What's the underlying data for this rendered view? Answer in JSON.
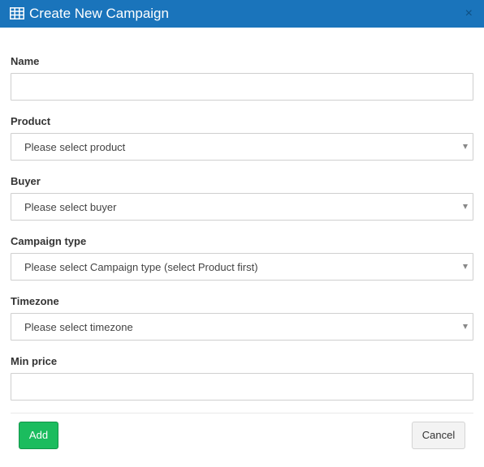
{
  "modal": {
    "title": "Create New Campaign",
    "close_glyph": "×",
    "header_icon": "table-icon",
    "header_color": "#1a74bb"
  },
  "form": {
    "name": {
      "label": "Name",
      "value": "",
      "placeholder": ""
    },
    "product": {
      "label": "Product",
      "selected": "Please select product"
    },
    "buyer": {
      "label": "Buyer",
      "selected": "Please select buyer"
    },
    "campaign_type": {
      "label": "Campaign type",
      "selected": "Please select Campaign type (select Product first)"
    },
    "timezone": {
      "label": "Timezone",
      "selected": "Please select timezone"
    },
    "min_price": {
      "label": "Min price",
      "value": "",
      "placeholder": ""
    }
  },
  "footer": {
    "add_label": "Add",
    "cancel_label": "Cancel",
    "add_color": "#1bbc5e"
  }
}
